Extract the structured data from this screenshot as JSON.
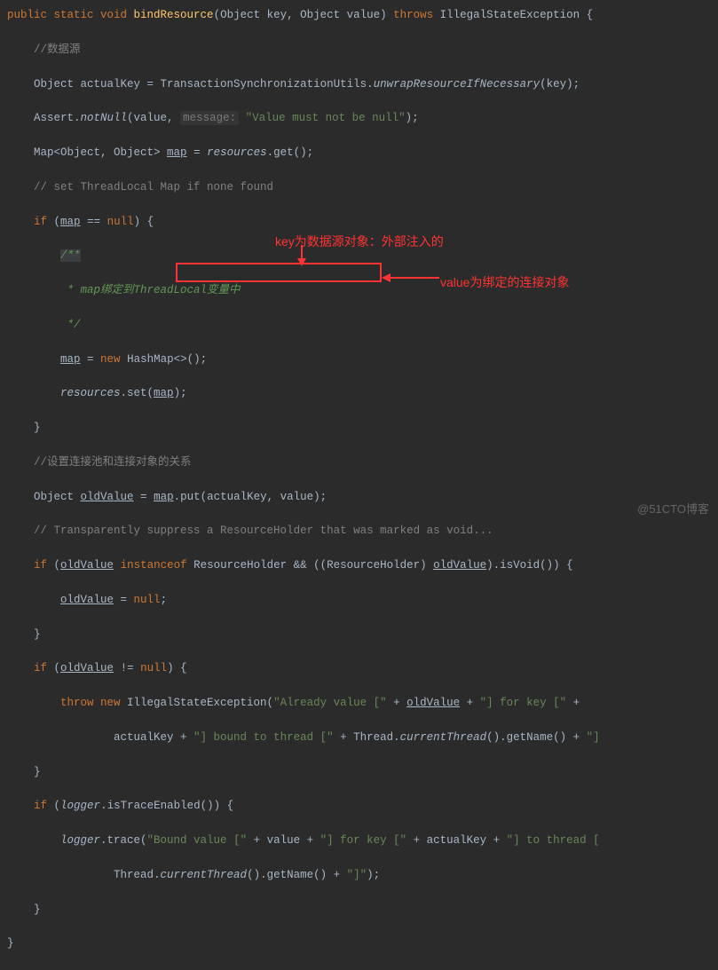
{
  "code": {
    "l1_public": "public ",
    "l1_static": "static ",
    "l1_void": "void ",
    "l1_method": "bindResource",
    "l1_sig1": "(Object key, Object value) ",
    "l1_throws": "throws ",
    "l1_exc": "IllegalStateException {",
    "l2_comment": "//数据源",
    "l3_a": "Object actualKey = TransactionSynchronizationUtils.",
    "l3_b": "unwrapResourceIfNecessary",
    "l3_c": "(key);",
    "l4_a": "Assert.",
    "l4_b": "notNull",
    "l4_c": "(value, ",
    "l4_hint": "message:",
    "l4_d": " \"Value must not be null\"",
    "l4_e": ");",
    "l5_a": "Map<Object, Object> ",
    "l5_map": "map",
    "l5_b": " = ",
    "l5_res": "resources",
    "l5_c": ".get();",
    "l6_comment": "// set ThreadLocal Map if none found",
    "l7_if": "if ",
    "l7_a": "(",
    "l7_map": "map",
    "l7_b": " == ",
    "l7_null": "null",
    "l7_c": ") {",
    "l8_doc": "/**",
    "l9_doc": " * map绑定到ThreadLocal变量中",
    "l10_doc": " */",
    "l11_map": "map",
    "l11_a": " = ",
    "l11_new": "new ",
    "l11_b": "HashMap<>();",
    "l12_res": "resources",
    "l12_a": ".set(",
    "l12_map": "map",
    "l12_b": ");",
    "l13_brace": "}",
    "l14_comment": "//设置连接池和连接对象的关系",
    "l15_a": "Object ",
    "l15_old": "oldValue",
    "l15_b": " = ",
    "l15_map": "map",
    "l15_c": ".put(actualKey, value);",
    "l16_comment": "// Transparently suppress a ResourceHolder that was marked as void...",
    "l17_if": "if ",
    "l17_a": "(",
    "l17_old1": "oldValue",
    "l17_b": " ",
    "l17_inst": "instanceof ",
    "l17_c": "ResourceHolder && ((ResourceHolder) ",
    "l17_old2": "oldValue",
    "l17_d": ").isVoid()) {",
    "l18_old": "oldValue",
    "l18_a": " = ",
    "l18_null": "null",
    "l18_b": ";",
    "l19_brace": "}",
    "l20_if": "if ",
    "l20_a": "(",
    "l20_old": "oldValue",
    "l20_b": " != ",
    "l20_null": "null",
    "l20_c": ") {",
    "l21_throw": "throw new ",
    "l21_a": "IllegalStateException(",
    "l21_s1": "\"Already value [\"",
    "l21_b": " + ",
    "l21_old": "oldValue",
    "l21_c": " + ",
    "l21_s2": "\"] for key [\"",
    "l21_d": " +",
    "l22_a": "actualKey + ",
    "l22_s1": "\"] bound to thread [\"",
    "l22_b": " + Thread.",
    "l22_ct": "currentThread",
    "l22_c": "().getName() + ",
    "l22_s2": "\"]",
    "l23_brace": "}",
    "l24_if": "if ",
    "l24_a": "(",
    "l24_log": "logger",
    "l24_b": ".isTraceEnabled()) {",
    "l25_log": "logger",
    "l25_a": ".trace(",
    "l25_s1": "\"Bound value [\"",
    "l25_b": " + value + ",
    "l25_s2": "\"] for key [\"",
    "l25_c": " + actualKey + ",
    "l25_s3": "\"] to thread [",
    "l26_a": "Thread.",
    "l26_ct": "currentThread",
    "l26_b": "().getName() + ",
    "l26_s1": "\"]\"",
    "l26_c": ");",
    "l27_brace": "}",
    "l28_brace": "}"
  },
  "annotations": {
    "top": "key为数据源对象：外部注入的",
    "right": "value为绑定的连接对象"
  },
  "watermark": "@51CTO博客"
}
